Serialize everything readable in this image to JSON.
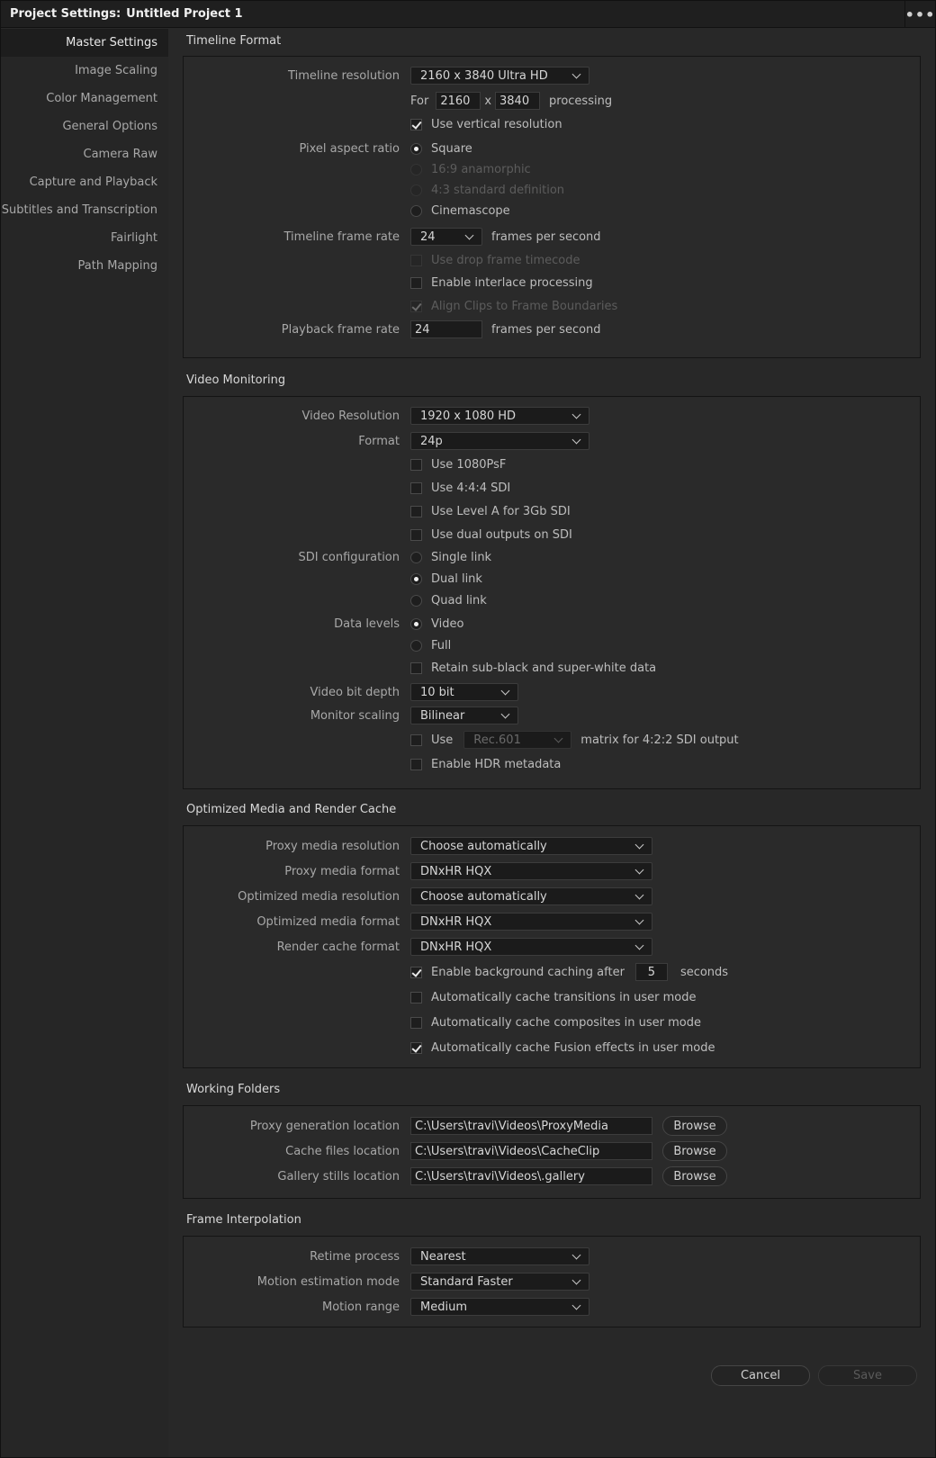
{
  "window": {
    "title_prefix": "Project Settings:",
    "project_name": "Untitled Project 1",
    "menu_glyph": "•••"
  },
  "sidebar": {
    "items": [
      {
        "label": "Master Settings",
        "active": true
      },
      {
        "label": "Image Scaling"
      },
      {
        "label": "Color Management"
      },
      {
        "label": "General Options"
      },
      {
        "label": "Camera Raw"
      },
      {
        "label": "Capture and Playback"
      },
      {
        "label": "Subtitles and Transcription"
      },
      {
        "label": "Fairlight"
      },
      {
        "label": "Path Mapping"
      }
    ]
  },
  "timeline_format": {
    "title": "Timeline Format",
    "resolution_label": "Timeline resolution",
    "resolution_value": "2160 x 3840 Ultra HD",
    "for_label": "For",
    "width_value": "2160",
    "x_label": "x",
    "height_value": "3840",
    "processing_label": "processing",
    "use_vertical": "Use vertical resolution",
    "pixel_aspect_label": "Pixel aspect ratio",
    "par_square": "Square",
    "par_anamorphic": "16:9 anamorphic",
    "par_sd": "4:3 standard definition",
    "par_cinemascope": "Cinemascope",
    "frame_rate_label": "Timeline frame rate",
    "frame_rate_value": "24",
    "fps_label": "frames per second",
    "drop_frame": "Use drop frame timecode",
    "interlace": "Enable interlace processing",
    "align_clips": "Align Clips to Frame Boundaries",
    "playback_label": "Playback frame rate",
    "playback_value": "24",
    "playback_fps": "frames per second"
  },
  "video_monitoring": {
    "title": "Video Monitoring",
    "resolution_label": "Video Resolution",
    "resolution_value": "1920 x 1080 HD",
    "format_label": "Format",
    "format_value": "24p",
    "psf": "Use 1080PsF",
    "sdi444": "Use 4:4:4 SDI",
    "levelA": "Use Level A for 3Gb SDI",
    "dual_outputs": "Use dual outputs on SDI",
    "sdi_label": "SDI configuration",
    "single_link": "Single link",
    "dual_link": "Dual link",
    "quad_link": "Quad link",
    "data_levels_label": "Data levels",
    "video": "Video",
    "full": "Full",
    "retain": "Retain sub-black and super-white data",
    "bit_depth_label": "Video bit depth",
    "bit_depth_value": "10 bit",
    "scaling_label": "Monitor scaling",
    "scaling_value": "Bilinear",
    "use_label": "Use",
    "matrix_value": "Rec.601",
    "matrix_suffix": "matrix for 4:2:2 SDI output",
    "hdr": "Enable HDR metadata"
  },
  "optimized": {
    "title": "Optimized Media and Render Cache",
    "proxy_res_label": "Proxy media resolution",
    "proxy_res_value": "Choose automatically",
    "proxy_fmt_label": "Proxy media format",
    "proxy_fmt_value": "DNxHR HQX",
    "opt_res_label": "Optimized media resolution",
    "opt_res_value": "Choose automatically",
    "opt_fmt_label": "Optimized media format",
    "opt_fmt_value": "DNxHR HQX",
    "render_label": "Render cache format",
    "render_value": "DNxHR HQX",
    "bg_cache": "Enable background caching after",
    "bg_seconds": "5",
    "seconds_label": "seconds",
    "cache_transitions": "Automatically cache transitions in user mode",
    "cache_composites": "Automatically cache composites in user mode",
    "cache_fusion": "Automatically cache Fusion effects in user mode"
  },
  "working_folders": {
    "title": "Working Folders",
    "proxy_label": "Proxy generation location",
    "proxy_path": "C:\\Users\\travi\\Videos\\ProxyMedia",
    "cache_label": "Cache files location",
    "cache_path": "C:\\Users\\travi\\Videos\\CacheClip",
    "gallery_label": "Gallery stills location",
    "gallery_path": "C:\\Users\\travi\\Videos\\.gallery",
    "browse": "Browse"
  },
  "frame_interpolation": {
    "title": "Frame Interpolation",
    "retime_label": "Retime process",
    "retime_value": "Nearest",
    "motion_label": "Motion estimation mode",
    "motion_value": "Standard Faster",
    "range_label": "Motion range",
    "range_value": "Medium"
  },
  "footer": {
    "cancel": "Cancel",
    "save": "Save"
  }
}
